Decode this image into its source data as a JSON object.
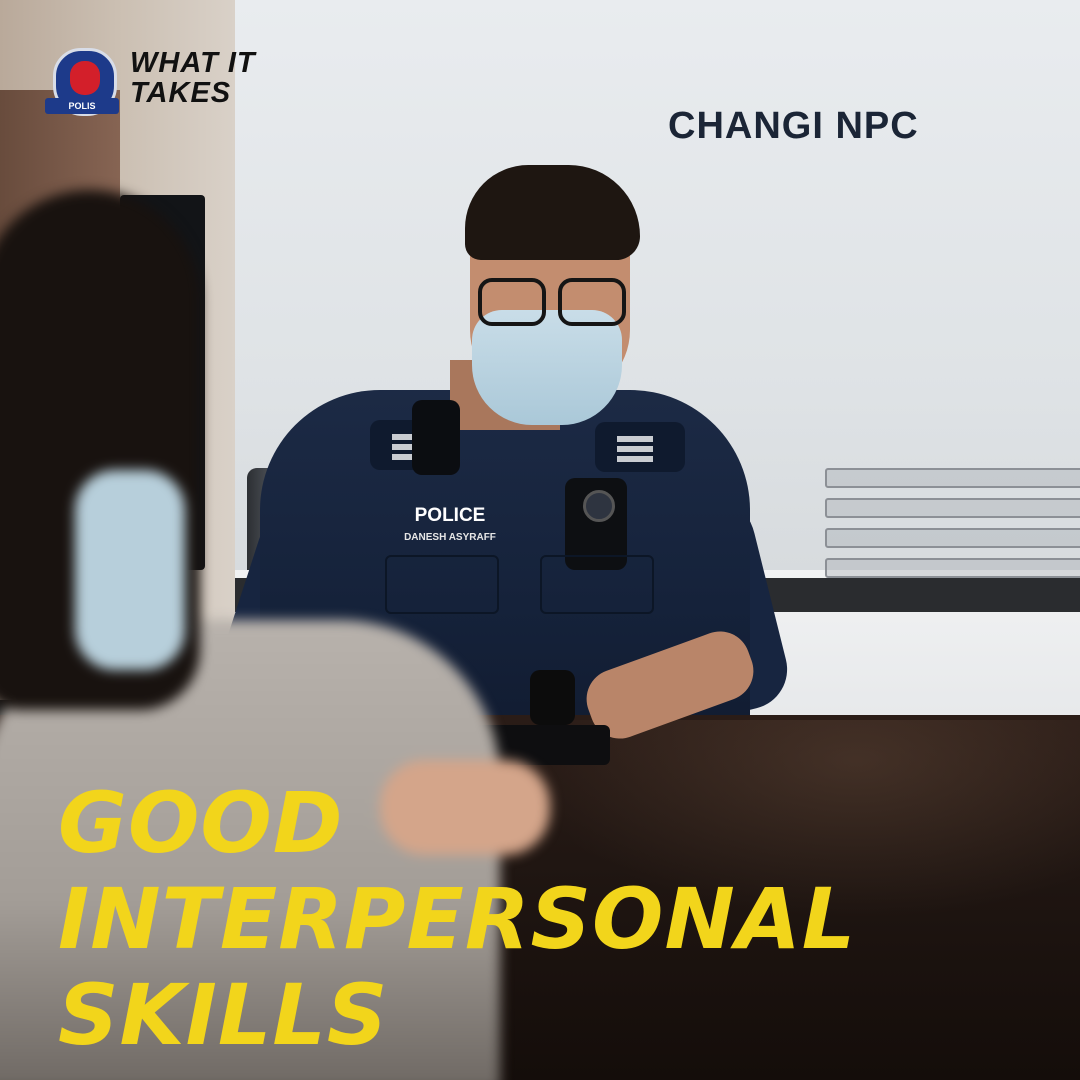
{
  "branding": {
    "logo_ribbon": "POLIS",
    "tagline_line1": "WHAT IT",
    "tagline_line2": "TAKES"
  },
  "scene": {
    "wall_sign": "CHANGI NPC",
    "uniform_label": "POLICE",
    "name_tag": "DANESH ASYRAFF"
  },
  "headline": {
    "line1": "GOOD",
    "line2": "INTERPERSONAL",
    "line3": "SKILLS"
  },
  "colors": {
    "headline": "#f2d51b",
    "uniform": "#15223a"
  }
}
